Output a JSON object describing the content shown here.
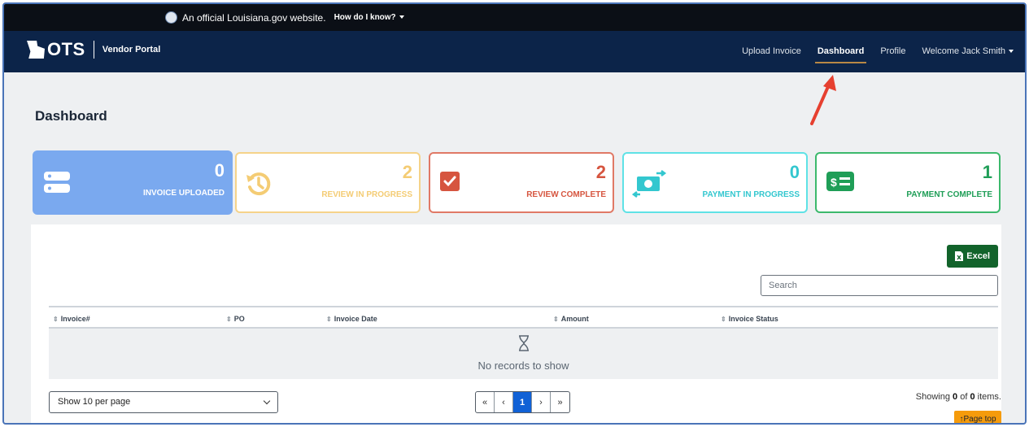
{
  "gov_banner": {
    "text": "An official Louisiana.gov website.",
    "how_label": "How do I know?"
  },
  "navbar": {
    "logo_text": "OTS",
    "portal_name": "Vendor Portal",
    "links": [
      "Upload Invoice",
      "Dashboard",
      "Profile",
      "Welcome Jack Smith"
    ],
    "active": "Dashboard"
  },
  "page": {
    "title": "Dashboard"
  },
  "cards": [
    {
      "count": "0",
      "label": "INVOICE UPLOADED",
      "color": "#7aa9ef"
    },
    {
      "count": "2",
      "label": "REVIEW IN PROGRESS",
      "color": "#f4cc74"
    },
    {
      "count": "2",
      "label": "REVIEW COMPLETE",
      "color": "#d6553f"
    },
    {
      "count": "0",
      "label": "PAYMENT IN PROGRESS",
      "color": "#33c7cf"
    },
    {
      "count": "1",
      "label": "PAYMENT COMPLETE",
      "color": "#1f9e57"
    }
  ],
  "table": {
    "excel_label": "Excel",
    "search_placeholder": "Search",
    "columns": [
      "Invoice#",
      "PO",
      "Invoice Date",
      "Amount",
      "Invoice Status"
    ],
    "empty_text": "No records to show"
  },
  "footer": {
    "per_page": "Show 10 per page",
    "pager": [
      "«",
      "‹",
      "1",
      "›",
      "»"
    ],
    "current_page": "1",
    "showing_prefix": "Showing",
    "showing_count": "0",
    "showing_of": "of",
    "showing_total": "0",
    "showing_suffix": "items.",
    "page_top": "Page top"
  },
  "icons": {
    "card_1": "server-icon",
    "card_2": "history-icon",
    "card_3": "checkbox-icon",
    "card_4": "money-exchange-icon",
    "card_5": "dollar-list-icon"
  }
}
